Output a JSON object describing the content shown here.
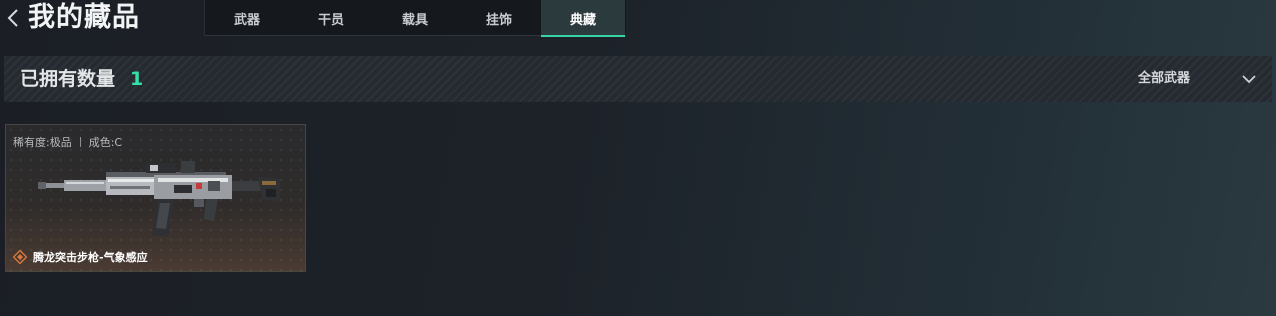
{
  "header": {
    "title": "我的藏品"
  },
  "tabs": [
    {
      "label": "武器",
      "active": false
    },
    {
      "label": "干员",
      "active": false
    },
    {
      "label": "载具",
      "active": false
    },
    {
      "label": "挂饰",
      "active": false
    },
    {
      "label": "典藏",
      "active": true
    }
  ],
  "summary": {
    "owned_label": "已拥有数量",
    "owned_count": "1",
    "filter_label": "全部武器"
  },
  "items": [
    {
      "rarity": "稀有度:极品",
      "condition": "成色:C",
      "name": "腾龙突击步枪-气象感应",
      "rarity_color": "#d9773a"
    }
  ],
  "colors": {
    "accent": "#35e0a8",
    "active_tab_bg": "#2b3a3d"
  }
}
